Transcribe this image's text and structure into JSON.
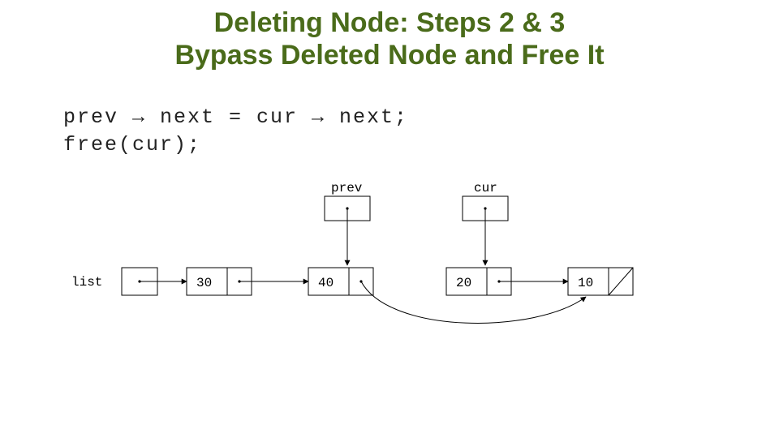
{
  "title_line1": "Deleting Node: Steps 2 & 3",
  "title_line2": "Bypass Deleted Node and Free It",
  "code_line1": "prev → next = cur → next;",
  "code_line2": "free(cur);",
  "labels": {
    "list": "list",
    "prev": "prev",
    "cur": "cur"
  },
  "nodes": {
    "v1": "30",
    "v2": "40",
    "v3": "20",
    "v4": "10"
  },
  "chart_data": {
    "type": "diagram",
    "structure": "singly-linked-list with prev and cur pointers",
    "list_values": [
      30,
      40,
      20,
      10
    ],
    "prev_points_to_value": 40,
    "cur_points_to_value": 20,
    "bypass_edge": {
      "from_value": 40,
      "to_value": 10,
      "meaning": "prev->next = cur->next"
    },
    "last_node_next": null
  }
}
